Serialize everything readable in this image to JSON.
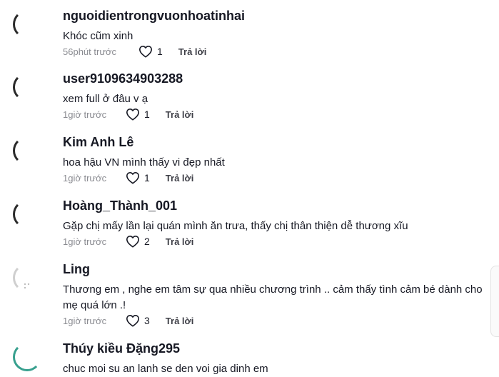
{
  "comments": [
    {
      "username": "nguoidientrongvuonhoatinhai",
      "text": "Khóc cũm xinh",
      "time": "56phút trước",
      "likes": "1",
      "reply_label": "Trả lời"
    },
    {
      "username": "user9109634903288",
      "text": "xem full ở đâu v ạ ",
      "time": "1giờ trước",
      "likes": "1",
      "reply_label": "Trả lời"
    },
    {
      "username": "Kim Anh Lê",
      "text": "hoa hậu VN mình thấy vi đẹp nhất",
      "time": "1giờ trước",
      "likes": "1",
      "reply_label": "Trả lời"
    },
    {
      "username": "Hoàng_Thành_001",
      "text": "Gặp chị mấy lần lại quán mình ăn trưa, thấy chị thân thiện dễ thương xĩu",
      "time": "1giờ trước",
      "likes": "2",
      "reply_label": "Trả lời"
    },
    {
      "username": "Ling",
      "text": "Thương em , nghe em tâm sự qua nhiều chương trình .. cảm thấy tình cảm bé dành cho mẹ quá lớn .!",
      "time": "1giờ trước",
      "likes": "3",
      "reply_label": "Trả lời"
    },
    {
      "username": "Thúy kiều Đặng295",
      "text": "chuc moi su an lanh se den voi gia dinh em"
    }
  ],
  "colors": {
    "text_primary": "#161823",
    "text_secondary": "#8a8b91",
    "avatar_accent": "#37a08e"
  }
}
